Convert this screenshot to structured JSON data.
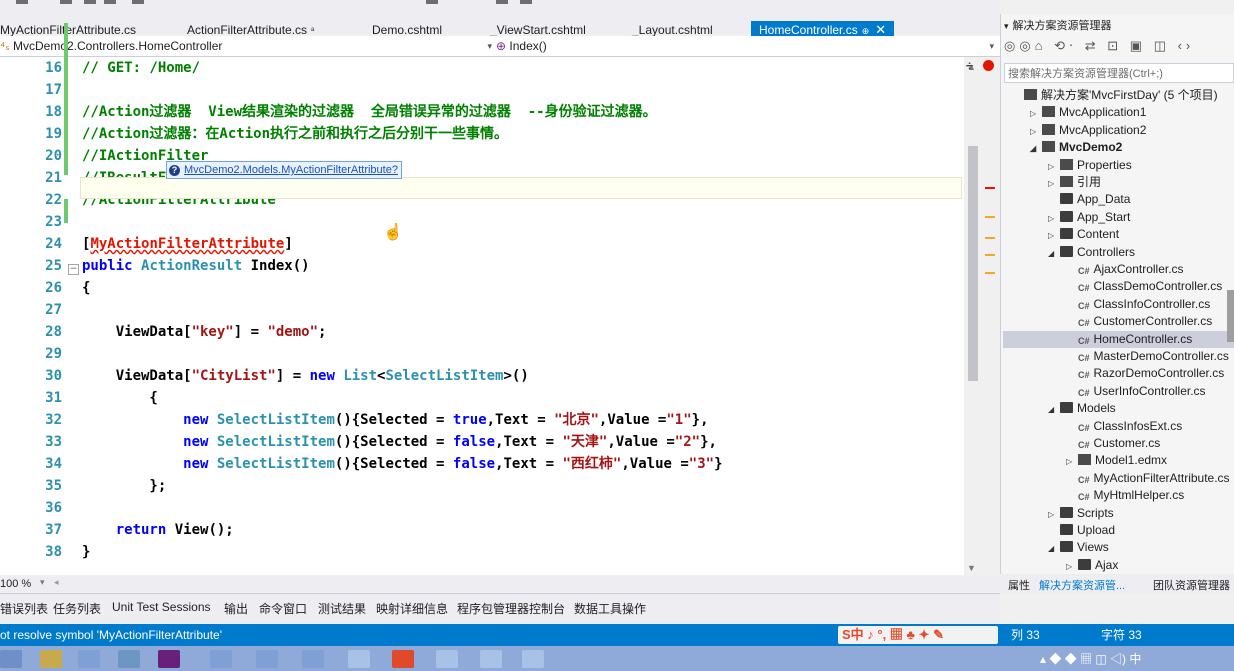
{
  "tabs": [
    {
      "label": "MyActionFilterAttribute.cs",
      "pin": ""
    },
    {
      "label": "ActionFilterAttribute.cs",
      "pin": "ª"
    },
    {
      "label": "Demo.cshtml",
      "pin": ""
    },
    {
      "label": "_ViewStart.cshtml",
      "pin": ""
    },
    {
      "label": "_Layout.cshtml",
      "pin": ""
    },
    {
      "label": "HomeController.cs",
      "pin": "⊕",
      "close": "✕"
    }
  ],
  "nav": {
    "type_combo": "MvcDemo2.Controllers.HomeController",
    "member_combo": "Index()"
  },
  "editor": {
    "lines": [
      {
        "num": "16",
        "segs": [
          [
            "cm",
            "// GET: /Home/"
          ]
        ]
      },
      {
        "num": "17",
        "segs": []
      },
      {
        "num": "18",
        "segs": [
          [
            "cm",
            "//Action过滤器  View结果渲染的过滤器  全局错误异常的过滤器  --身份验证过滤器。"
          ]
        ]
      },
      {
        "num": "19",
        "segs": [
          [
            "cm",
            "//Action过滤器：在Action执行之前和执行之后分别干一些事情。"
          ]
        ]
      },
      {
        "num": "20",
        "segs": [
          [
            "cm",
            "//IActionFilter"
          ]
        ]
      },
      {
        "num": "21",
        "segs": [
          [
            "cm",
            "//IResultFilter"
          ]
        ]
      },
      {
        "num": "22",
        "segs": [
          [
            "cm",
            "//ActionFilterAttribute"
          ]
        ]
      },
      {
        "num": "23",
        "segs": []
      },
      {
        "num": "24",
        "segs": [
          [
            "tx",
            "["
          ],
          [
            "err",
            "MyActionFilterAttribute"
          ],
          [
            "tx",
            "]"
          ]
        ]
      },
      {
        "num": "25",
        "segs": [
          [
            "kw",
            "public "
          ],
          [
            "ty",
            "ActionResult "
          ],
          [
            "tx",
            "Index()"
          ]
        ]
      },
      {
        "num": "26",
        "segs": [
          [
            "tx",
            "{"
          ]
        ]
      },
      {
        "num": "27",
        "segs": []
      },
      {
        "num": "28",
        "segs": [
          [
            "tx",
            "    ViewData["
          ],
          [
            "st",
            "\"key\""
          ],
          [
            "tx",
            "] = "
          ],
          [
            "st",
            "\"demo\""
          ],
          [
            "tx",
            ";"
          ]
        ]
      },
      {
        "num": "29",
        "segs": []
      },
      {
        "num": "30",
        "segs": [
          [
            "tx",
            "    ViewData["
          ],
          [
            "st",
            "\"CityList\""
          ],
          [
            "tx",
            "] = "
          ],
          [
            "kw",
            "new "
          ],
          [
            "ty",
            "List"
          ],
          [
            "tx",
            "<"
          ],
          [
            "ty",
            "SelectListItem"
          ],
          [
            "tx",
            ">()"
          ]
        ]
      },
      {
        "num": "31",
        "segs": [
          [
            "tx",
            "        {"
          ]
        ]
      },
      {
        "num": "32",
        "segs": [
          [
            "tx",
            "            "
          ],
          [
            "kw",
            "new "
          ],
          [
            "ty",
            "SelectListItem"
          ],
          [
            "tx",
            "(){Selected = "
          ],
          [
            "kw",
            "true"
          ],
          [
            "tx",
            ",Text = "
          ],
          [
            "st",
            "\"北京\""
          ],
          [
            "tx",
            ",Value ="
          ],
          [
            "st",
            "\"1\""
          ],
          [
            "tx",
            "},"
          ]
        ]
      },
      {
        "num": "33",
        "segs": [
          [
            "tx",
            "            "
          ],
          [
            "kw",
            "new "
          ],
          [
            "ty",
            "SelectListItem"
          ],
          [
            "tx",
            "(){Selected = "
          ],
          [
            "kw",
            "false"
          ],
          [
            "tx",
            ",Text = "
          ],
          [
            "st",
            "\"天津\""
          ],
          [
            "tx",
            ",Value ="
          ],
          [
            "st",
            "\"2\""
          ],
          [
            "tx",
            "},"
          ]
        ]
      },
      {
        "num": "34",
        "segs": [
          [
            "tx",
            "            "
          ],
          [
            "kw",
            "new "
          ],
          [
            "ty",
            "SelectListItem"
          ],
          [
            "tx",
            "(){Selected = "
          ],
          [
            "kw",
            "false"
          ],
          [
            "tx",
            ",Text = "
          ],
          [
            "st",
            "\"西红柿\""
          ],
          [
            "tx",
            ",Value ="
          ],
          [
            "st",
            "\"3\""
          ],
          [
            "tx",
            "}"
          ]
        ]
      },
      {
        "num": "35",
        "segs": [
          [
            "tx",
            "        };"
          ]
        ]
      },
      {
        "num": "36",
        "segs": []
      },
      {
        "num": "37",
        "segs": [
          [
            "tx",
            "    "
          ],
          [
            "kw",
            "return "
          ],
          [
            "tx",
            "View();"
          ]
        ]
      },
      {
        "num": "38",
        "segs": [
          [
            "tx",
            "}"
          ]
        ]
      }
    ],
    "tooltip": "MvcDemo2.Models.MyActionFilterAttribute?",
    "zoom": "100 %"
  },
  "output_tabs": [
    "错误列表",
    "任务列表",
    "Unit Test Sessions",
    "输出",
    "命令窗口",
    "测试结果",
    "映射详细信息",
    "程序包管理器控制台",
    "数据工具操作"
  ],
  "solution_explorer": {
    "title": "解决方案资源管理器",
    "toolbar_icons": "◎◎⌂ ⟲‧ ⇄ ⊡ ▣ ◫ ‹›",
    "search_placeholder": "搜索解决方案资源管理器(Ctrl+;)",
    "items": [
      {
        "label": "解决方案'MvcFirstDay' (5 个项目)",
        "indent": 0,
        "exp": "",
        "icon": "proj"
      },
      {
        "label": "MvcApplication1",
        "indent": 1,
        "exp": "▷",
        "icon": "proj"
      },
      {
        "label": "MvcApplication2",
        "indent": 1,
        "exp": "▷",
        "icon": "proj"
      },
      {
        "label": "MvcDemo2",
        "indent": 1,
        "exp": "◢",
        "icon": "proj",
        "bold": true
      },
      {
        "label": "Properties",
        "indent": 2,
        "exp": "▷",
        "icon": "wrench"
      },
      {
        "label": "引用",
        "indent": 2,
        "exp": "▷",
        "icon": "ref"
      },
      {
        "label": "App_Data",
        "indent": 2,
        "exp": "",
        "icon": "folder"
      },
      {
        "label": "App_Start",
        "indent": 2,
        "exp": "▷",
        "icon": "folder"
      },
      {
        "label": "Content",
        "indent": 2,
        "exp": "▷",
        "icon": "folder"
      },
      {
        "label": "Controllers",
        "indent": 2,
        "exp": "◢",
        "icon": "folder"
      },
      {
        "label": "AjaxController.cs",
        "indent": 3,
        "exp": "",
        "icon": "cs"
      },
      {
        "label": "ClassDemoController.cs",
        "indent": 3,
        "exp": "",
        "icon": "cs"
      },
      {
        "label": "ClassInfoController.cs",
        "indent": 3,
        "exp": "",
        "icon": "cs"
      },
      {
        "label": "CustomerController.cs",
        "indent": 3,
        "exp": "",
        "icon": "cs"
      },
      {
        "label": "HomeController.cs",
        "indent": 3,
        "exp": "",
        "icon": "cs"
      },
      {
        "label": "MasterDemoController.cs",
        "indent": 3,
        "exp": "",
        "icon": "cs"
      },
      {
        "label": "RazorDemoController.cs",
        "indent": 3,
        "exp": "",
        "icon": "cs"
      },
      {
        "label": "UserInfoController.cs",
        "indent": 3,
        "exp": "",
        "icon": "cs"
      },
      {
        "label": "Models",
        "indent": 2,
        "exp": "◢",
        "icon": "folder"
      },
      {
        "label": "ClassInfosExt.cs",
        "indent": 3,
        "exp": "",
        "icon": "cs"
      },
      {
        "label": "Customer.cs",
        "indent": 3,
        "exp": "",
        "icon": "cs"
      },
      {
        "label": "Model1.edmx",
        "indent": 3,
        "exp": "▷",
        "icon": "edmx"
      },
      {
        "label": "MyActionFilterAttribute.cs",
        "indent": 3,
        "exp": "",
        "icon": "cs"
      },
      {
        "label": "MyHtmlHelper.cs",
        "indent": 3,
        "exp": "",
        "icon": "cs"
      },
      {
        "label": "Scripts",
        "indent": 2,
        "exp": "▷",
        "icon": "folder"
      },
      {
        "label": "Upload",
        "indent": 2,
        "exp": "",
        "icon": "folder"
      },
      {
        "label": "Views",
        "indent": 2,
        "exp": "◢",
        "icon": "folder"
      },
      {
        "label": "Ajax",
        "indent": 3,
        "exp": "▷",
        "icon": "folder"
      }
    ],
    "bottom_tabs": [
      "属性",
      "解决方案资源管...",
      "团队资源管理器"
    ]
  },
  "status": {
    "message": "ot resolve symbol 'MyActionFilterAttribute'",
    "col": "列 33",
    "char": "字符 33",
    "ime": "S中 ♪ °, ▦ ♣ ✦ ✎"
  },
  "colors": {
    "accent": "#007ACC",
    "error": "#E51400",
    "comment": "#008000",
    "keyword": "#0000FF",
    "type": "#2B91AF",
    "string": "#A31515"
  }
}
